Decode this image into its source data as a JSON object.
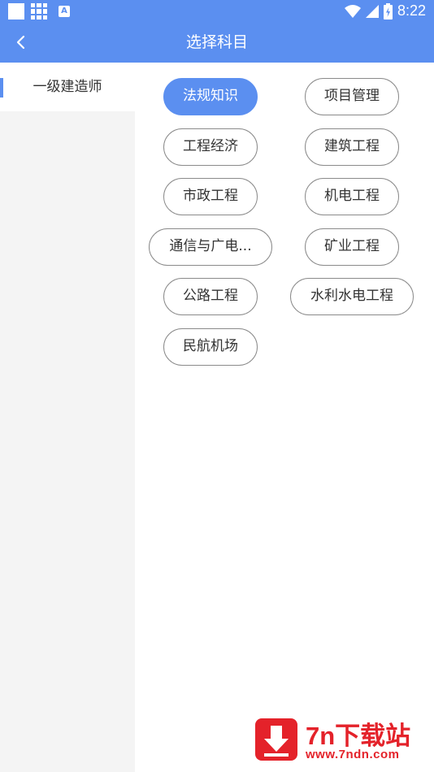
{
  "status_bar": {
    "time": "8:22",
    "left_icons": [
      "blank-square-icon",
      "grid-app-icon",
      "a-notification-icon"
    ],
    "a_icon_letter": "A",
    "right_icons": [
      "wifi-icon",
      "cell-signal-icon",
      "battery-charging-icon"
    ]
  },
  "app_bar": {
    "title": "选择科目",
    "back_icon": "chevron-left-icon"
  },
  "sidebar": {
    "items": [
      {
        "label": "一级建造师",
        "selected": true
      }
    ]
  },
  "subjects": [
    {
      "label": "法规知识",
      "selected": true
    },
    {
      "label": "项目管理",
      "selected": false
    },
    {
      "label": "工程经济",
      "selected": false
    },
    {
      "label": "建筑工程",
      "selected": false
    },
    {
      "label": "市政工程",
      "selected": false
    },
    {
      "label": "机电工程",
      "selected": false
    },
    {
      "label": "通信与广电...",
      "selected": false
    },
    {
      "label": "矿业工程",
      "selected": false
    },
    {
      "label": "公路工程",
      "selected": false
    },
    {
      "label": "水利水电工程",
      "selected": false
    },
    {
      "label": "民航机场",
      "selected": false
    }
  ],
  "colors": {
    "primary": "#5b8ff0",
    "chip_border": "#8a8a8a",
    "sidebar_bg": "#f4f4f4",
    "watermark_red": "#e4222a"
  },
  "watermark": {
    "brand": "7n下载站",
    "url": "www.7ndn.com",
    "icon": "download-arrow-icon"
  }
}
